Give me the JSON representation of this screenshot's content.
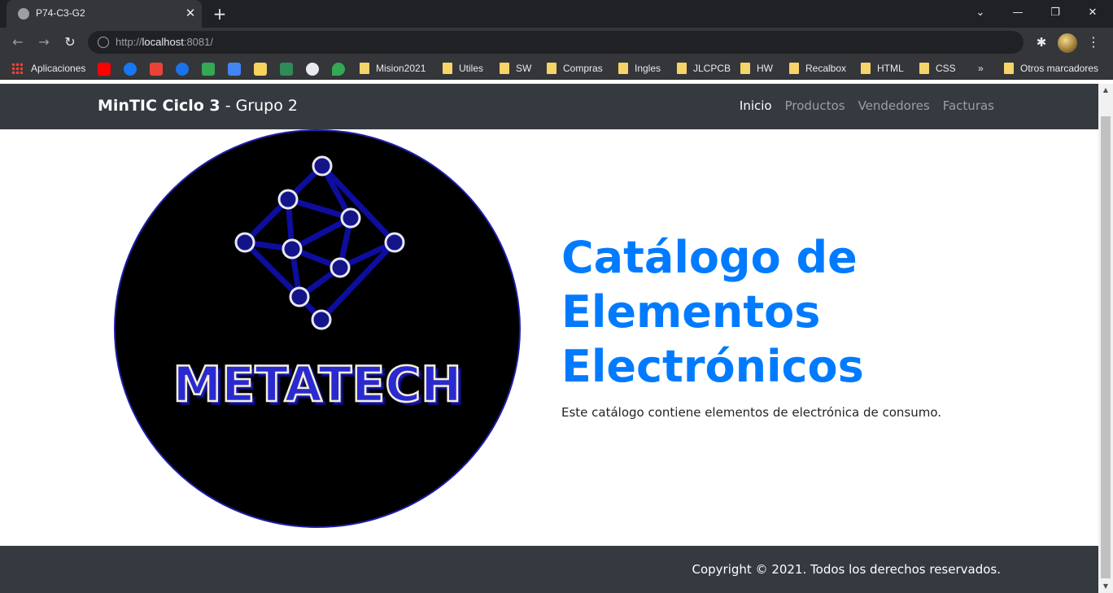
{
  "browser": {
    "tab_title": "P74-C3-G2",
    "url_scheme": "http://",
    "url_host": "localhost",
    "url_rest": ":8081/",
    "window_controls": [
      "chevron-down",
      "minimize",
      "restore",
      "close"
    ]
  },
  "bookmarks": {
    "apps_label": "Aplicaciones",
    "icons": [
      "youtube-icon",
      "facebook-icon",
      "gmail-icon",
      "c-icon",
      "drive-icon",
      "translate-icon",
      "cloud-icon",
      "leaf-icon",
      "github-icon",
      "maps-icon"
    ],
    "folders": [
      "Mision2021",
      "Utiles",
      "SW",
      "Compras",
      "Ingles",
      "JLCPCB",
      "HW",
      "Recalbox",
      "HTML",
      "CSS"
    ],
    "overflow": "»",
    "other": "Otros marcadores"
  },
  "navbar": {
    "brand_bold": "MinTIC Ciclo 3",
    "brand_rest": " - Grupo 2",
    "links": [
      {
        "label": "Inicio",
        "active": true
      },
      {
        "label": "Productos",
        "active": false
      },
      {
        "label": "Vendedores",
        "active": false
      },
      {
        "label": "Facturas",
        "active": false
      }
    ]
  },
  "hero": {
    "logo_text": "METATECH",
    "title_lines": [
      "Catálogo de",
      "Elementos",
      "Electrónicos"
    ],
    "subtitle": "Este catálogo contiene elementos de electrónica de consumo."
  },
  "footer": {
    "copyright": "Copyright © 2021. Todos los derechos reservados."
  },
  "colors": {
    "accent": "#007bff",
    "navbar_bg": "#343a40",
    "logo_node": "#1a1aa6"
  }
}
